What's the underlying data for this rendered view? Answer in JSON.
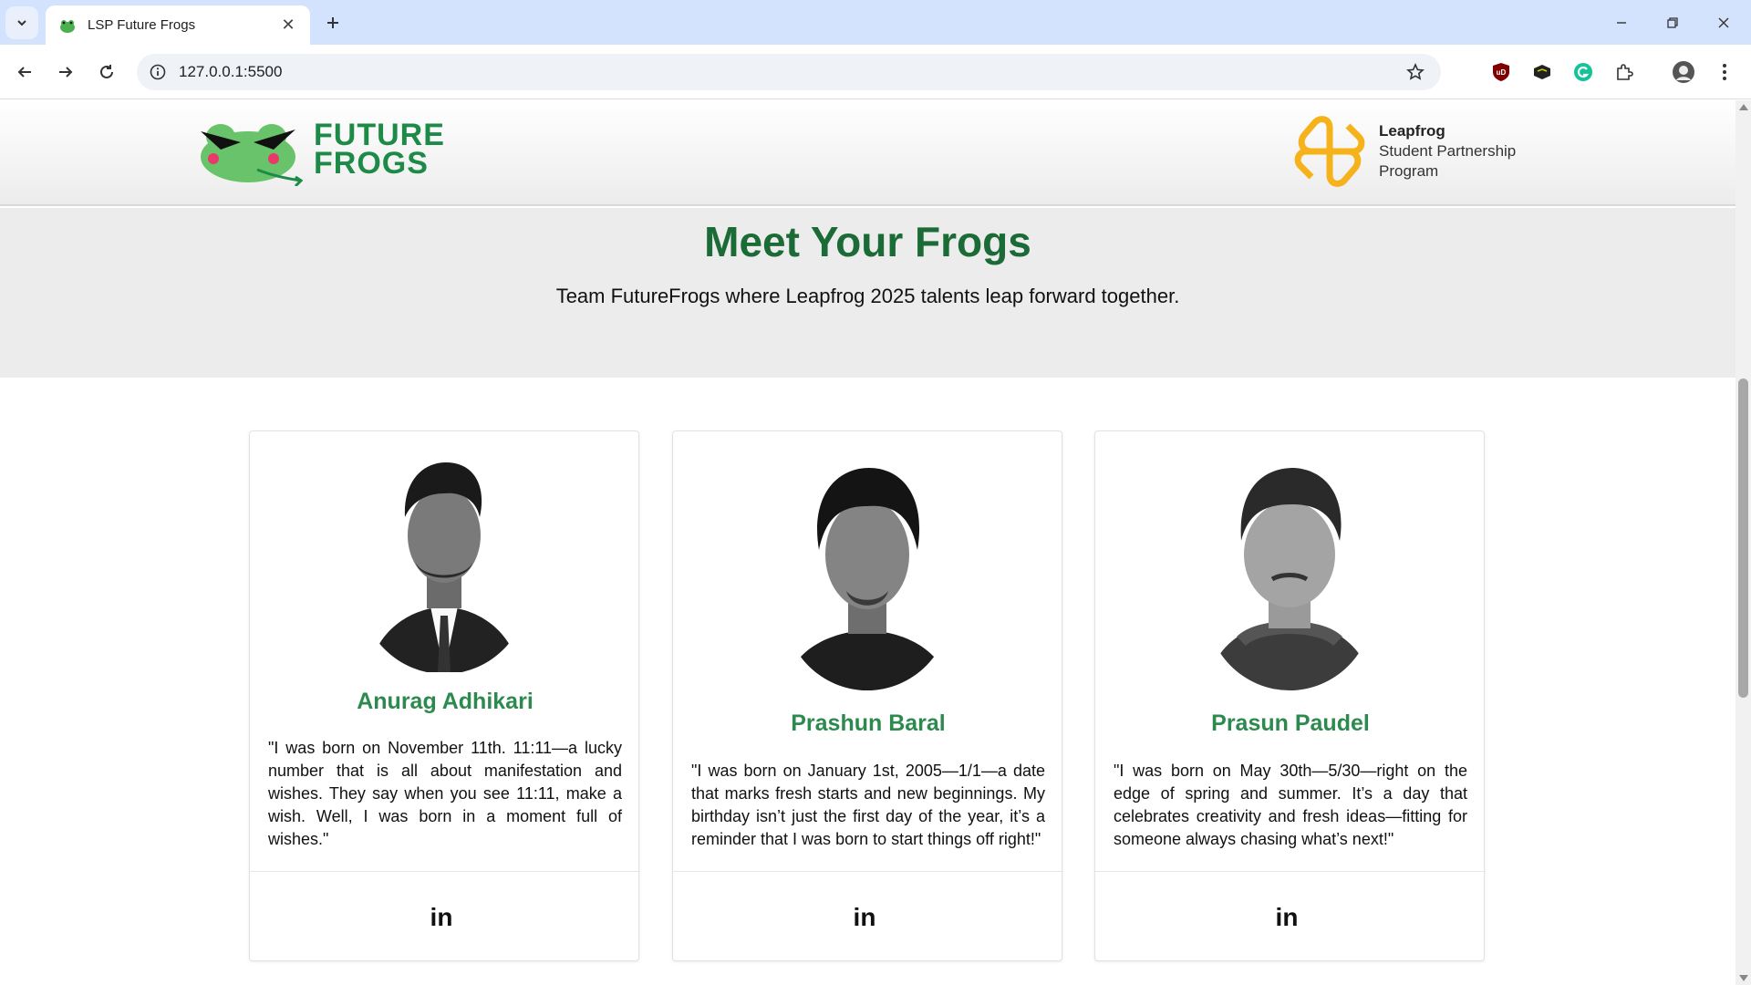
{
  "browser": {
    "tab_title": "LSP Future Frogs",
    "url": "127.0.0.1:5500"
  },
  "header": {
    "logo_line1": "FUTURE",
    "logo_line2": "FROGS",
    "partner_brand": "Leapfrog",
    "partner_line2": "Student Partnership",
    "partner_line3": "Program"
  },
  "hero": {
    "title": "Meet Your Frogs",
    "subtitle": "Team FutureFrogs where Leapfrog 2025 talents leap forward together."
  },
  "members": [
    {
      "name": "Anurag Adhikari",
      "quote": "\"I was born on November 11th. 11:11—a lucky number that is all about manifestation and wishes. They say when you see 11:11, make a wish. Well, I was born in a moment full of wishes.\"",
      "social": "in"
    },
    {
      "name": "Prashun Baral",
      "quote": "\"I was born on January 1st, 2005—1/1—a date that marks fresh starts and new beginnings. My birthday isn’t just the first day of the year, it’s a reminder that I was born to start things off right!\"",
      "social": "in"
    },
    {
      "name": "Prasun Paudel",
      "quote": "\"I was born on May 30th—5/30—right on the edge of spring and summer. It’s a day that celebrates creativity and fresh ideas—fitting for someone always chasing what’s next!\"",
      "social": "in"
    }
  ],
  "colors": {
    "brand_green": "#1b6b37",
    "name_green": "#2d8a4f",
    "leapfrog_orange": "#f5b21b",
    "frog_pink": "#e8396a"
  }
}
